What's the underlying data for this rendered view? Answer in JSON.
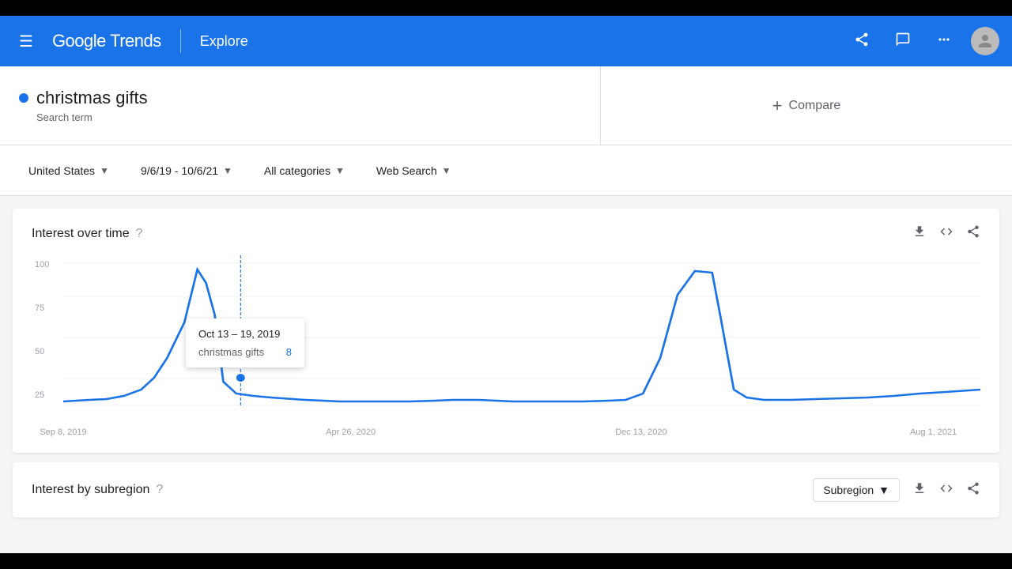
{
  "header": {
    "menu_label": "☰",
    "logo": "Google Trends",
    "explore": "Explore",
    "share_icon": "↗",
    "feedback_icon": "▤",
    "apps_icon": "⋮⋮⋮",
    "avatar_initial": "👤"
  },
  "search": {
    "term": "christmas gifts",
    "term_label": "Search term",
    "compare_label": "Compare",
    "compare_plus": "+"
  },
  "filters": {
    "region": "United States",
    "date_range": "9/6/19 - 10/6/21",
    "categories": "All categories",
    "search_type": "Web Search"
  },
  "interest_over_time": {
    "title": "Interest over time",
    "tooltip": {
      "date": "Oct 13 – 19, 2019",
      "term": "christmas gifts",
      "value": "8"
    },
    "y_axis": [
      "100",
      "75",
      "50",
      "25"
    ],
    "x_axis": [
      "Sep 8, 2019",
      "Apr 26, 2020",
      "Dec 13, 2020",
      "Aug 1, 2021"
    ],
    "download_icon": "⬇",
    "embed_icon": "<>",
    "share_icon": "↗"
  },
  "interest_by_subregion": {
    "title": "Interest by subregion",
    "subregion_label": "Subregion",
    "download_icon": "⬇",
    "embed_icon": "<>",
    "share_icon": "↗"
  }
}
